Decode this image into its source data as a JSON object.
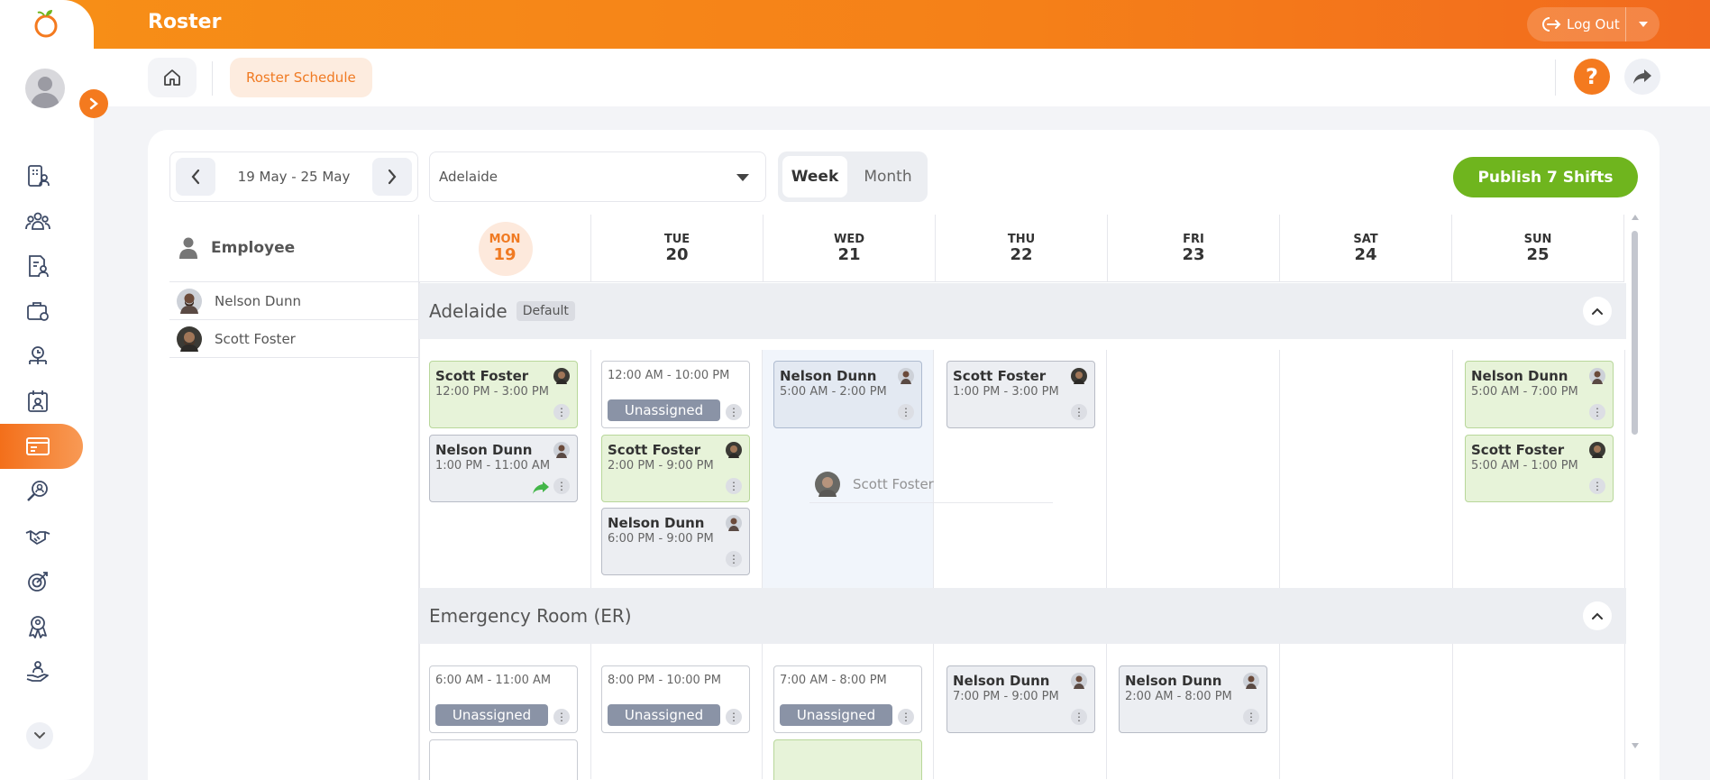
{
  "app": {
    "title": "Roster"
  },
  "header": {
    "logout_label": "Log Out"
  },
  "breadcrumb": {
    "current": "Roster Schedule"
  },
  "sidebar": {
    "icons": [
      "building-user-icon",
      "team-icon",
      "document-user-icon",
      "briefcase-gear-icon",
      "org-clock-icon",
      "calendar-user-icon",
      "roster-icon",
      "search-user-icon",
      "handshake-icon",
      "target-icon",
      "award-icon",
      "hand-user-icon"
    ],
    "active_index": 6
  },
  "toolbar": {
    "date_range": "19 May - 25 May",
    "location": "Adelaide",
    "view_week": "Week",
    "view_month": "Month",
    "publish_label": "Publish 7 Shifts"
  },
  "employee_panel": {
    "header": "Employee",
    "employees": [
      {
        "name": "Nelson Dunn"
      },
      {
        "name": "Scott Foster"
      }
    ]
  },
  "days": [
    {
      "dow": "MON",
      "date": "19",
      "today": true
    },
    {
      "dow": "TUE",
      "date": "20"
    },
    {
      "dow": "WED",
      "date": "21"
    },
    {
      "dow": "THU",
      "date": "22"
    },
    {
      "dow": "FRI",
      "date": "23"
    },
    {
      "dow": "SAT",
      "date": "24"
    },
    {
      "dow": "SUN",
      "date": "25"
    }
  ],
  "sections": [
    {
      "name": "Adelaide",
      "tag": "Default",
      "shifts": [
        {
          "day": 0,
          "row": 0,
          "employee": "Scott Foster",
          "time": "12:00 PM - 3:00 PM",
          "status": "green"
        },
        {
          "day": 0,
          "row": 1,
          "employee": "Nelson Dunn",
          "time": "1:00 PM - 11:00 AM",
          "status": "gray",
          "forwarded": true
        },
        {
          "day": 1,
          "row": 0,
          "employee": "",
          "time": "12:00 AM - 10:00 PM",
          "status": "open",
          "unassigned_label": "Unassigned"
        },
        {
          "day": 1,
          "row": 1,
          "employee": "Scott Foster",
          "time": "2:00 PM - 9:00 PM",
          "status": "green"
        },
        {
          "day": 1,
          "row": 2,
          "employee": "Nelson Dunn",
          "time": "6:00 PM - 9:00 PM",
          "status": "gray"
        },
        {
          "day": 2,
          "row": 0,
          "employee": "Nelson Dunn",
          "time": "5:00 AM - 2:00 PM",
          "status": "blue"
        },
        {
          "day": 3,
          "row": 0,
          "employee": "Scott Foster",
          "time": "1:00 PM - 3:00 PM",
          "status": "gray"
        },
        {
          "day": 6,
          "row": 0,
          "employee": "Nelson Dunn",
          "time": "5:00 AM - 7:00 PM",
          "status": "green"
        },
        {
          "day": 6,
          "row": 1,
          "employee": "Scott Foster",
          "time": "5:00 AM - 1:00 PM",
          "status": "green"
        }
      ]
    },
    {
      "name": "Emergency Room (ER)",
      "tag": "",
      "shifts": [
        {
          "day": 0,
          "row": 0,
          "employee": "",
          "time": "6:00 AM - 11:00 AM",
          "status": "open",
          "unassigned_label": "Unassigned"
        },
        {
          "day": 1,
          "row": 0,
          "employee": "",
          "time": "8:00 PM - 10:00 PM",
          "status": "open",
          "unassigned_label": "Unassigned"
        },
        {
          "day": 2,
          "row": 0,
          "employee": "",
          "time": "7:00 AM - 8:00 PM",
          "status": "open",
          "unassigned_label": "Unassigned"
        },
        {
          "day": 3,
          "row": 0,
          "employee": "Nelson Dunn",
          "time": "7:00 PM - 9:00 PM",
          "status": "gray"
        },
        {
          "day": 4,
          "row": 0,
          "employee": "Nelson Dunn",
          "time": "2:00 AM - 8:00 PM",
          "status": "gray"
        }
      ]
    }
  ],
  "drag_preview": {
    "employee": "Scott Foster"
  },
  "colors": {
    "accent": "#f47a1f",
    "publish": "#6fb51e",
    "today_bg": "#fde9dc"
  }
}
